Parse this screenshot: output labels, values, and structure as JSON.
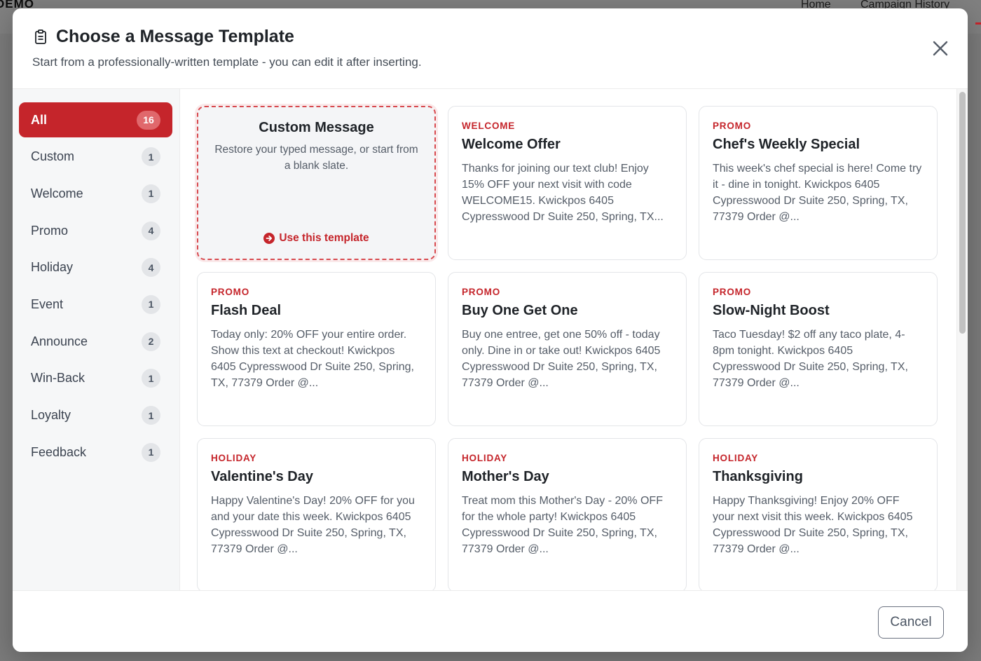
{
  "background": {
    "brand": "DEMO",
    "nav": [
      "Home",
      "Campaign History"
    ]
  },
  "modal": {
    "title": "Choose a Message Template",
    "title_icon": "clipboard-list-icon",
    "subtitle": "Start from a professionally-written template - you can edit it after inserting.",
    "close_icon": "close-icon",
    "cancel_label": "Cancel"
  },
  "sidebar": {
    "categories": [
      {
        "label": "All",
        "count": "16",
        "active": true
      },
      {
        "label": "Custom",
        "count": "1"
      },
      {
        "label": "Welcome",
        "count": "1"
      },
      {
        "label": "Promo",
        "count": "4"
      },
      {
        "label": "Holiday",
        "count": "4"
      },
      {
        "label": "Event",
        "count": "1"
      },
      {
        "label": "Announce",
        "count": "2"
      },
      {
        "label": "Win-Back",
        "count": "1"
      },
      {
        "label": "Loyalty",
        "count": "1"
      },
      {
        "label": "Feedback",
        "count": "1"
      }
    ]
  },
  "custom_card": {
    "title": "Custom Message",
    "description": "Restore your typed message, or start from a blank slate.",
    "action": "Use this template",
    "action_icon": "arrow-circle-right-icon"
  },
  "templates": [
    {
      "category": "WELCOME",
      "title": "Welcome Offer",
      "body": "Thanks for joining our text club! Enjoy 15% OFF your next visit with code WELCOME15. Kwickpos 6405 Cypresswood Dr Suite 250, Spring, TX..."
    },
    {
      "category": "PROMO",
      "title": "Chef's Weekly Special",
      "body": "This week's chef special is here! Come try it - dine in tonight. Kwickpos 6405 Cypresswood Dr Suite 250, Spring, TX, 77379 Order @..."
    },
    {
      "category": "PROMO",
      "title": "Flash Deal",
      "body": "Today only: 20% OFF your entire order. Show this text at checkout! Kwickpos 6405 Cypresswood Dr Suite 250, Spring, TX, 77379 Order @..."
    },
    {
      "category": "PROMO",
      "title": "Buy One Get One",
      "body": "Buy one entree, get one 50% off - today only. Dine in or take out! Kwickpos 6405 Cypresswood Dr Suite 250, Spring, TX, 77379 Order @..."
    },
    {
      "category": "PROMO",
      "title": "Slow-Night Boost",
      "body": "Taco Tuesday! $2 off any taco plate, 4-8pm tonight. Kwickpos 6405 Cypresswood Dr Suite 250, Spring, TX, 77379 Order @..."
    },
    {
      "category": "HOLIDAY",
      "title": "Valentine's Day",
      "body": "Happy Valentine's Day! 20% OFF for you and your date this week. Kwickpos 6405 Cypresswood Dr Suite 250, Spring, TX, 77379 Order @..."
    },
    {
      "category": "HOLIDAY",
      "title": "Mother's Day",
      "body": "Treat mom this Mother's Day - 20% OFF for the whole party! Kwickpos 6405 Cypresswood Dr Suite 250, Spring, TX, 77379 Order @..."
    },
    {
      "category": "HOLIDAY",
      "title": "Thanksgiving",
      "body": "Happy Thanksgiving! Enjoy 20% OFF your next visit this week. Kwickpos 6405 Cypresswood Dr Suite 250, Spring, TX, 77379 Order @..."
    }
  ],
  "colors": {
    "accent": "#c5252b",
    "overlay": "#7b7b7b"
  }
}
